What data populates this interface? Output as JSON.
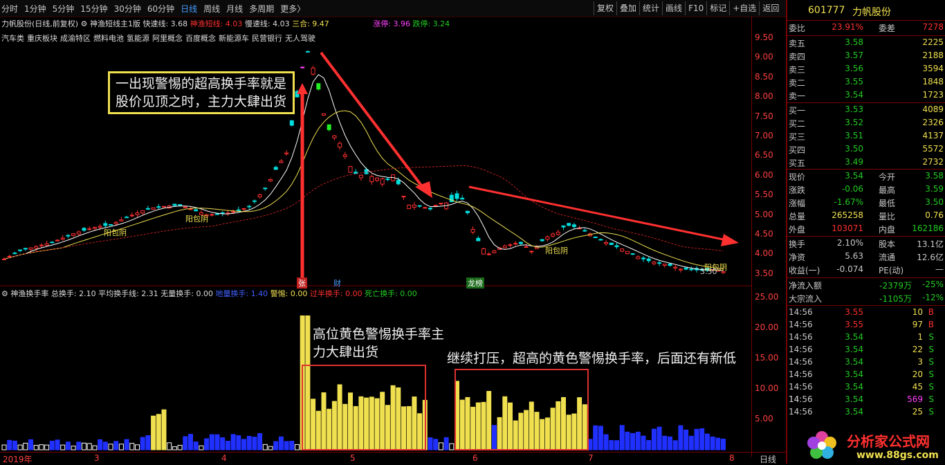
{
  "toolbar": {
    "periods": [
      "分时",
      "1分钟",
      "5分钟",
      "15分钟",
      "30分钟",
      "60分钟",
      "日线",
      "周线",
      "月线",
      "多周期",
      "更多〉"
    ],
    "active_period": "日线",
    "right_buttons": [
      "复权",
      "叠加",
      "统计",
      "画线",
      "F10",
      "标记",
      "+自选",
      "返回"
    ]
  },
  "main_indicator": {
    "stock_label": "力帆股份(日线,前复权)",
    "indicator_name": "神渔短线主1版",
    "fast_line": "快速线: 3.68",
    "danger_line": "神渔短线: 4.03",
    "slow_line": "慢速线: 4.03",
    "sanhe": "三合: 9.47",
    "zhangting": "涨停: 3.96",
    "dieting": "跌停: 3.24"
  },
  "concepts": [
    "汽车类",
    "重庆板块",
    "成渝特区",
    "燃料电池",
    "氢能源",
    "阿里概念",
    "百度概念",
    "新能源车",
    "民营银行",
    "无人驾驶"
  ],
  "sub_indicator": {
    "name": "神渔换手率",
    "total": "总换手: 2.10",
    "avg": "平均换手线: 2.31",
    "none": "无量换手: 0.00",
    "low": "地量换手: 1.40",
    "alert": "警惕: 0.00",
    "over": "过半换手: 0.00",
    "dead": "死亡换手: 0.00"
  },
  "annotations": {
    "box1": "一出现警惕的超高换手率就是股价见顶之时，主力大肆出货",
    "ann2": "高位黄色警惕换手率主力大肆出货",
    "ann3": "继续打压，超高的黄色警惕换手率，后面还有新低"
  },
  "chart_labels": {
    "yang1": "阳包阴",
    "yang2": "阳包阴",
    "yang3": "阳包阴",
    "yang4": "阳包阴",
    "zhang": "张",
    "cai": "财",
    "longhu": "龙榜",
    "price_tag": "3.50"
  },
  "price_axis": [
    "9.50",
    "9.00",
    "8.50",
    "8.00",
    "7.50",
    "7.00",
    "6.50",
    "6.00",
    "5.50",
    "5.00",
    "4.50",
    "4.00",
    "3.50"
  ],
  "turnover_axis": [
    "25.00",
    "20.00",
    "15.00",
    "10.00",
    "5.00"
  ],
  "x_axis": [
    "2019年",
    "3",
    "4",
    "5",
    "6",
    "7",
    "8",
    "日线"
  ],
  "quote": {
    "code": "601777",
    "name": "力帆股份",
    "weibi_label": "委比",
    "weibi": "23.91%",
    "weicha_label": "委差",
    "weicha": "7278",
    "sell": [
      {
        "label": "卖五",
        "price": "3.58",
        "vol": "2225"
      },
      {
        "label": "卖四",
        "price": "3.57",
        "vol": "2188"
      },
      {
        "label": "卖三",
        "price": "3.56",
        "vol": "3594"
      },
      {
        "label": "卖二",
        "price": "3.55",
        "vol": "1848"
      },
      {
        "label": "卖一",
        "price": "3.54",
        "vol": "1723"
      }
    ],
    "buy": [
      {
        "label": "买一",
        "price": "3.53",
        "vol": "4089"
      },
      {
        "label": "买二",
        "price": "3.52",
        "vol": "2326"
      },
      {
        "label": "买三",
        "price": "3.51",
        "vol": "4137"
      },
      {
        "label": "买四",
        "price": "3.50",
        "vol": "5572"
      },
      {
        "label": "买五",
        "price": "3.49",
        "vol": "2732"
      }
    ],
    "stats": [
      {
        "l1": "现价",
        "v1": "3.54",
        "l2": "今开",
        "v2": "3.58"
      },
      {
        "l1": "涨跌",
        "v1": "-0.06",
        "l2": "最高",
        "v2": "3.59"
      },
      {
        "l1": "涨幅",
        "v1": "-1.67%",
        "l2": "最低",
        "v2": "3.50"
      },
      {
        "l1": "总量",
        "v1": "265258",
        "l2": "量比",
        "v2": "0.76"
      },
      {
        "l1": "外盘",
        "v1": "103071",
        "l2": "内盘",
        "v2": "162186"
      }
    ],
    "stats2": [
      {
        "l1": "换手",
        "v1": "2.10%",
        "l2": "股本",
        "v2": "13.1亿"
      },
      {
        "l1": "净资",
        "v1": "5.63",
        "l2": "流通",
        "v2": "12.6亿"
      },
      {
        "l1": "收益(一)",
        "v1": "-0.074",
        "l2": "PE(动)",
        "v2": "—"
      }
    ],
    "flow": [
      {
        "l": "净流入额",
        "v": "-2379万",
        "p": "-25%"
      },
      {
        "l": "大宗流入",
        "v": "-1105万",
        "p": "-12%"
      }
    ],
    "ticks": [
      {
        "t": "14:56",
        "p": "3.55",
        "v": "10",
        "f": "B"
      },
      {
        "t": "14:56",
        "p": "3.55",
        "v": "97",
        "f": "B"
      },
      {
        "t": "14:56",
        "p": "3.54",
        "v": "1",
        "f": "S"
      },
      {
        "t": "14:56",
        "p": "3.54",
        "v": "22",
        "f": "S"
      },
      {
        "t": "14:56",
        "p": "3.54",
        "v": "3",
        "f": "S"
      },
      {
        "t": "14:56",
        "p": "3.54",
        "v": "20",
        "f": "S"
      },
      {
        "t": "14:56",
        "p": "3.54",
        "v": "45",
        "f": "S"
      },
      {
        "t": "14:56",
        "p": "3.54",
        "v": "569",
        "f": "S"
      },
      {
        "t": "14:56",
        "p": "3.54",
        "v": "25",
        "f": "S"
      }
    ],
    "tick_extra": "14"
  },
  "logo": {
    "text": "分析家公式网",
    "url": "www.88gs.com"
  },
  "colors": {
    "up": "#ff3030",
    "down": "#22cc22",
    "yellow": "#f0e050",
    "blue": "#2040ff",
    "magenta": "#ff40ff"
  }
}
